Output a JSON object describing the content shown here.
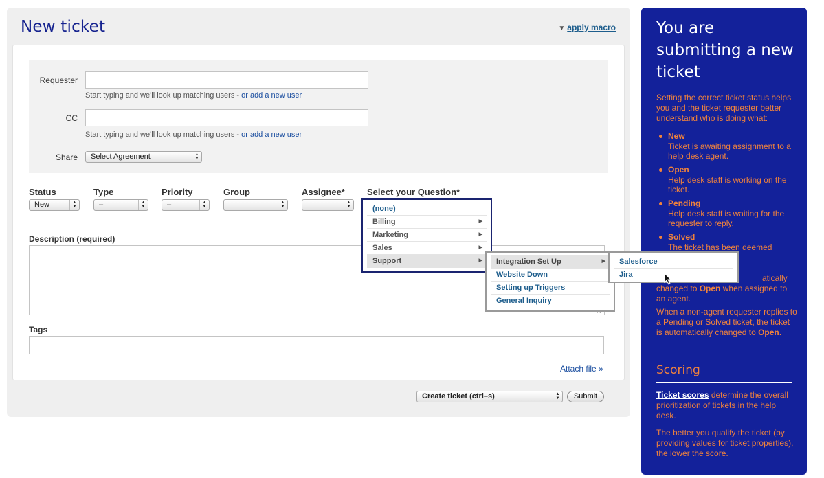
{
  "header": {
    "title": "New ticket",
    "macro_link": "apply macro"
  },
  "people": {
    "requester_label": "Requester",
    "requester_value": "",
    "requester_hint": "Start typing and we'll look up matching users - ",
    "requester_hint_link": "or add a new user",
    "cc_label": "CC",
    "cc_value": "",
    "cc_hint": "Start typing and we'll look up matching users - ",
    "cc_hint_link": "or add a new user",
    "share_label": "Share",
    "share_value": "Select Agreement"
  },
  "properties": {
    "status_label": "Status",
    "status_value": "New",
    "type_label": "Type",
    "type_value": "–",
    "priority_label": "Priority",
    "priority_value": "–",
    "group_label": "Group",
    "group_value": "",
    "assignee_label": "Assignee*",
    "assignee_value": "",
    "question_label": "Select your Question*"
  },
  "question_menu": {
    "level1": [
      "(none)",
      "Billing",
      "Marketing",
      "Sales",
      "Support"
    ],
    "level2": [
      "Integration Set Up",
      "Website Down",
      "Setting up Triggers",
      "General Inquiry"
    ],
    "level3": [
      "Salesforce",
      "Jira"
    ]
  },
  "description": {
    "label": "Description (required)",
    "value": ""
  },
  "tags": {
    "label": "Tags",
    "value": ""
  },
  "attach_link": "Attach file »",
  "footer": {
    "submit_action": "Create ticket (ctrl–s)",
    "submit_button": "Submit"
  },
  "sidebar": {
    "title": "You are submitting a new ticket",
    "intro": "Setting the correct ticket status helps you and the ticket requester better understand who is doing what:",
    "statuses": [
      {
        "name": "New",
        "desc": "Ticket is awaiting assignment to a help desk agent."
      },
      {
        "name": "Open",
        "desc": "Help desk staff is working on the ticket."
      },
      {
        "name": "Pending",
        "desc": "Help desk staff is waiting for the requester to reply."
      },
      {
        "name": "Solved",
        "desc": "The ticket has been deemed"
      }
    ],
    "partial_line1": "atically",
    "partial_line2_a": "changed to ",
    "partial_line2_b": "Open",
    "partial_line2_c": " when assigned to",
    "partial_line3": "an agent.",
    "reply_note_a": "When a non-agent requester replies to a Pending or Solved ticket, the ticket is automatically changed to ",
    "reply_note_b": "Open",
    "reply_note_c": ".",
    "scoring_title": "Scoring",
    "scoring_link": "Ticket scores",
    "scoring_text": " determine the overall prioritization of tickets in the help desk.",
    "scoring_note": "The better you qualify the ticket (by providing values for ticket properties), the lower the score."
  },
  "colors": {
    "brand_blue": "#13219a",
    "accent_orange": "#f0823c",
    "title_blue": "#16238f",
    "link_blue": "#1d5d8c"
  }
}
